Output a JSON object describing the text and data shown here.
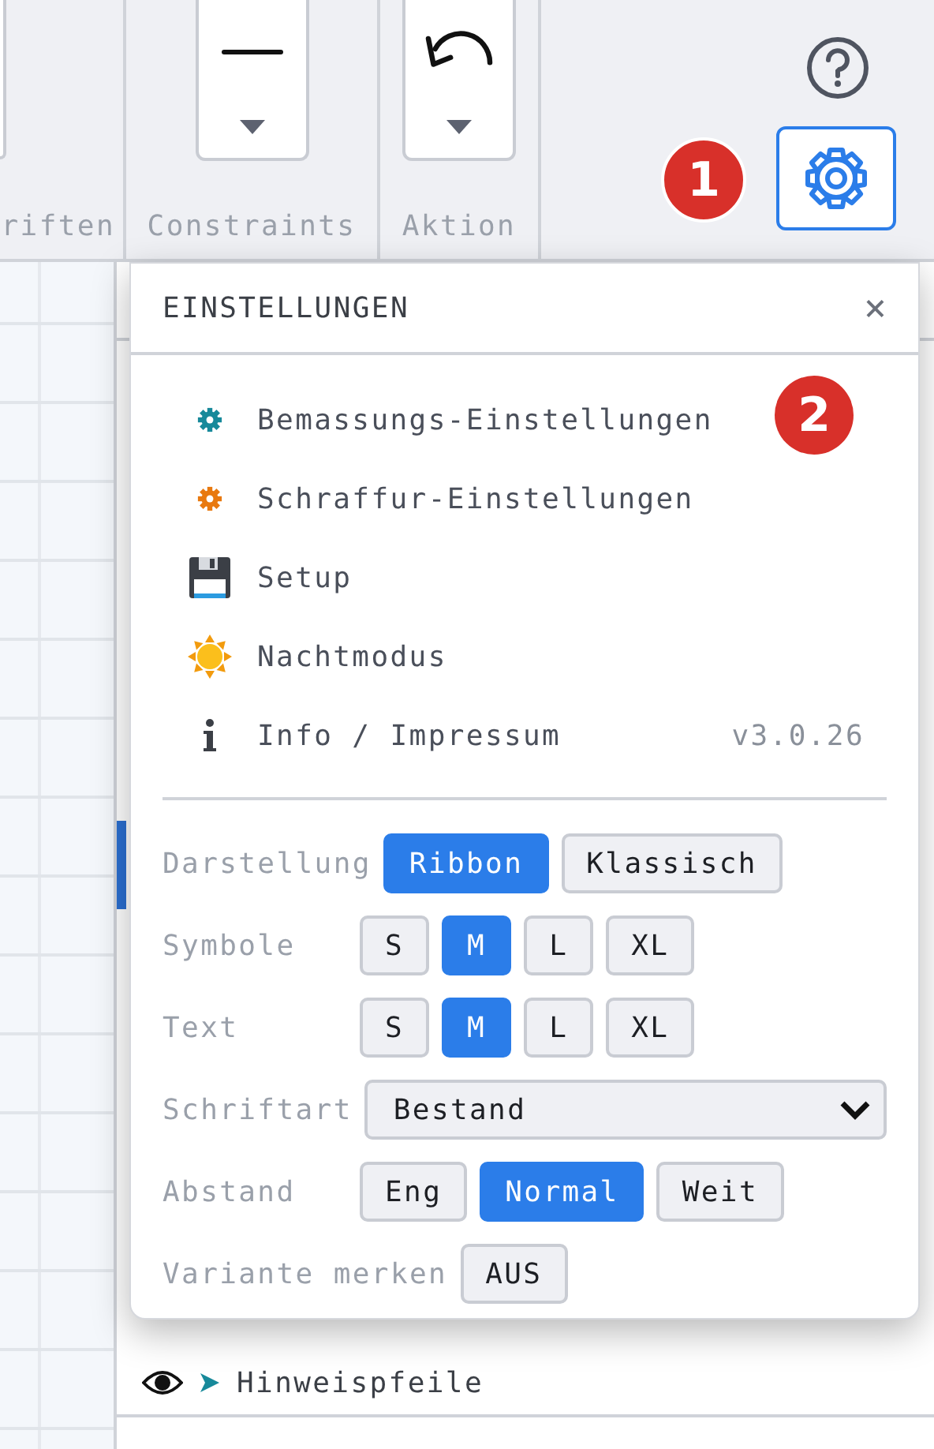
{
  "ribbon": {
    "groups": [
      {
        "label": "riften",
        "kind": "cut"
      },
      {
        "label": "Constraints",
        "kind": "line"
      },
      {
        "label": "Aktion",
        "kind": "undo"
      }
    ],
    "settings_button": {
      "selected": true
    }
  },
  "badges": [
    "1",
    "2"
  ],
  "dialog": {
    "title": "EINSTELLUNGEN",
    "close": "×",
    "menu": [
      {
        "label": "Bemassungs-Einstellungen",
        "kind": "gear",
        "color": "#17899a"
      },
      {
        "label": "Schraffur-Einstellungen",
        "kind": "gear",
        "color": "#e8790f"
      },
      {
        "label": "Setup",
        "kind": "floppy"
      },
      {
        "label": "Nachtmodus",
        "kind": "sun"
      },
      {
        "label": "Info / Impressum",
        "kind": "info",
        "version": "v3.0.26"
      }
    ],
    "settings": [
      {
        "label": "Darstellung",
        "kind": "buttons",
        "options": [
          {
            "label": "Ribbon",
            "selected": true
          },
          {
            "label": "Klassisch",
            "selected": false
          }
        ]
      },
      {
        "label": "Symbole",
        "kind": "buttons",
        "options": [
          {
            "label": "S",
            "selected": false
          },
          {
            "label": "M",
            "selected": true
          },
          {
            "label": "L",
            "selected": false
          },
          {
            "label": "XL",
            "selected": false
          }
        ]
      },
      {
        "label": "Text",
        "kind": "buttons",
        "options": [
          {
            "label": "S",
            "selected": false
          },
          {
            "label": "M",
            "selected": true
          },
          {
            "label": "L",
            "selected": false
          },
          {
            "label": "XL",
            "selected": false
          }
        ]
      },
      {
        "label": "Schriftart",
        "kind": "select",
        "value": "Bestand"
      },
      {
        "label": "Abstand",
        "kind": "buttons",
        "options": [
          {
            "label": "Eng",
            "selected": false
          },
          {
            "label": "Normal",
            "selected": true
          },
          {
            "label": "Weit",
            "selected": false
          }
        ]
      },
      {
        "label": "Variante merken",
        "kind": "buttons",
        "options": [
          {
            "label": "AUS",
            "selected": false
          }
        ]
      }
    ]
  },
  "layers": [
    {
      "label": "Hinweispfeile",
      "visible": true
    }
  ]
}
